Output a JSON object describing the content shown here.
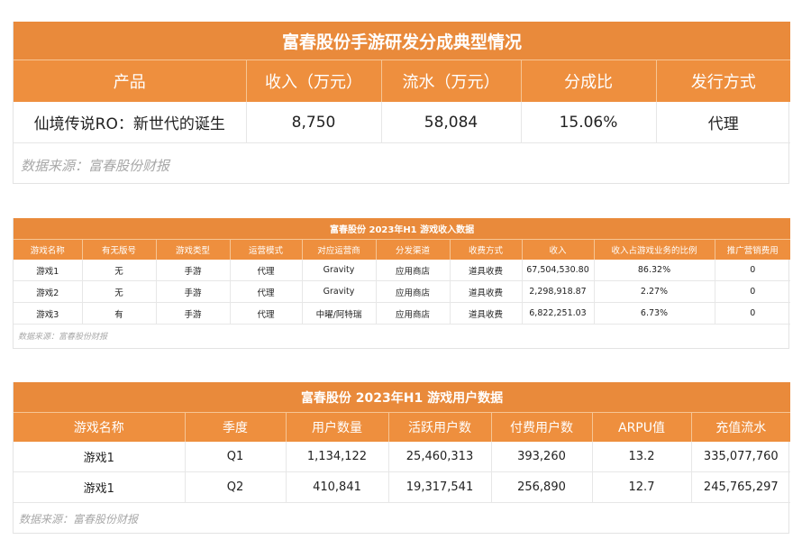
{
  "table1": {
    "title": "富春股份手游研发分成典型情况",
    "headers": [
      "产品",
      "收入（万元）",
      "流水（万元）",
      "分成比",
      "发行方式"
    ],
    "rows": [
      [
        "仙境传说RO：新世代的诞生",
        "8,750",
        "58,084",
        "15.06%",
        "代理"
      ]
    ],
    "source": "数据来源：富春股份财报"
  },
  "table2": {
    "title": "富春股份 2023年H1 游戏收入数据",
    "headers": [
      "游戏名称",
      "有无版号",
      "游戏类型",
      "运营模式",
      "对应运营商",
      "分发渠道",
      "收费方式",
      "收入",
      "收入占游戏业务的比例",
      "推广营销费用"
    ],
    "rows": [
      [
        "游戏1",
        "无",
        "手游",
        "代理",
        "Gravity",
        "应用商店",
        "道具收费",
        "67,504,530.80",
        "86.32%",
        "0"
      ],
      [
        "游戏2",
        "无",
        "手游",
        "代理",
        "Gravity",
        "应用商店",
        "道具收费",
        "2,298,918.87",
        "2.27%",
        "0"
      ],
      [
        "游戏3",
        "有",
        "手游",
        "代理",
        "中曜/阿特瑞",
        "应用商店",
        "道具收费",
        "6,822,251.03",
        "6.73%",
        "0"
      ]
    ],
    "source": "数据来源：富春股份财报"
  },
  "table3": {
    "title": "富春股份 2023年H1 游戏用户数据",
    "headers": [
      "游戏名称",
      "季度",
      "用户数量",
      "活跃用户数",
      "付费用户数",
      "ARPU值",
      "充值流水"
    ],
    "rows": [
      [
        "游戏1",
        "Q1",
        "1,134,122",
        "25,460,313",
        "393,260",
        "13.2",
        "335,077,760"
      ],
      [
        "游戏1",
        "Q2",
        "410,841",
        "19,317,541",
        "256,890",
        "12.7",
        "245,765,297"
      ]
    ],
    "source": "数据来源：富春股份财报"
  }
}
